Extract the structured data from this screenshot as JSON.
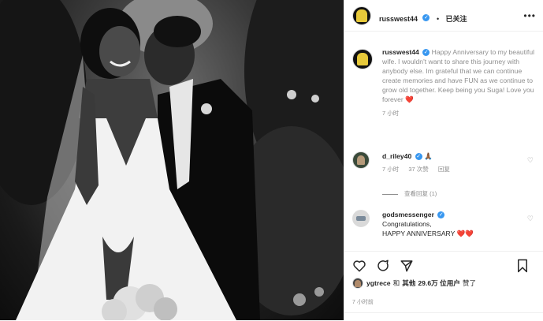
{
  "post": {
    "username": "russwest44",
    "follow_label": "已关注",
    "more_icon": "more-icon",
    "verified_icon": "verified-badge-icon"
  },
  "caption": {
    "username": "russwest44",
    "text": "Happy Anniversary to my beautiful wife. I wouldn't want to share this journey with anybody else. Im grateful that we can continue create memories and have FUN as we continue to grow old together. Keep being you Suga! Love you forever",
    "emoji": "❤️",
    "time": "7 小时"
  },
  "comments": [
    {
      "username": "d_riley40",
      "text": "🙏🏾",
      "time": "7 小时",
      "likes": "37 次赞",
      "reply": "回复"
    },
    {
      "username": "godsmessenger",
      "text_line1": "Congratulations,",
      "text_line2": "HAPPY ANNIVERSARY",
      "emoji": "❤️❤️"
    }
  ],
  "view_replies": "查看回复 (1)",
  "likes": {
    "user": "ygtrece",
    "and": "和",
    "others": "其他",
    "count": "29.6万 位用户",
    "suffix": "赞了"
  },
  "post_time": "7 小时前",
  "colors": {
    "accent": "#3897f0",
    "heart": "#ed4956",
    "secondary_text": "#8e8e8e"
  }
}
